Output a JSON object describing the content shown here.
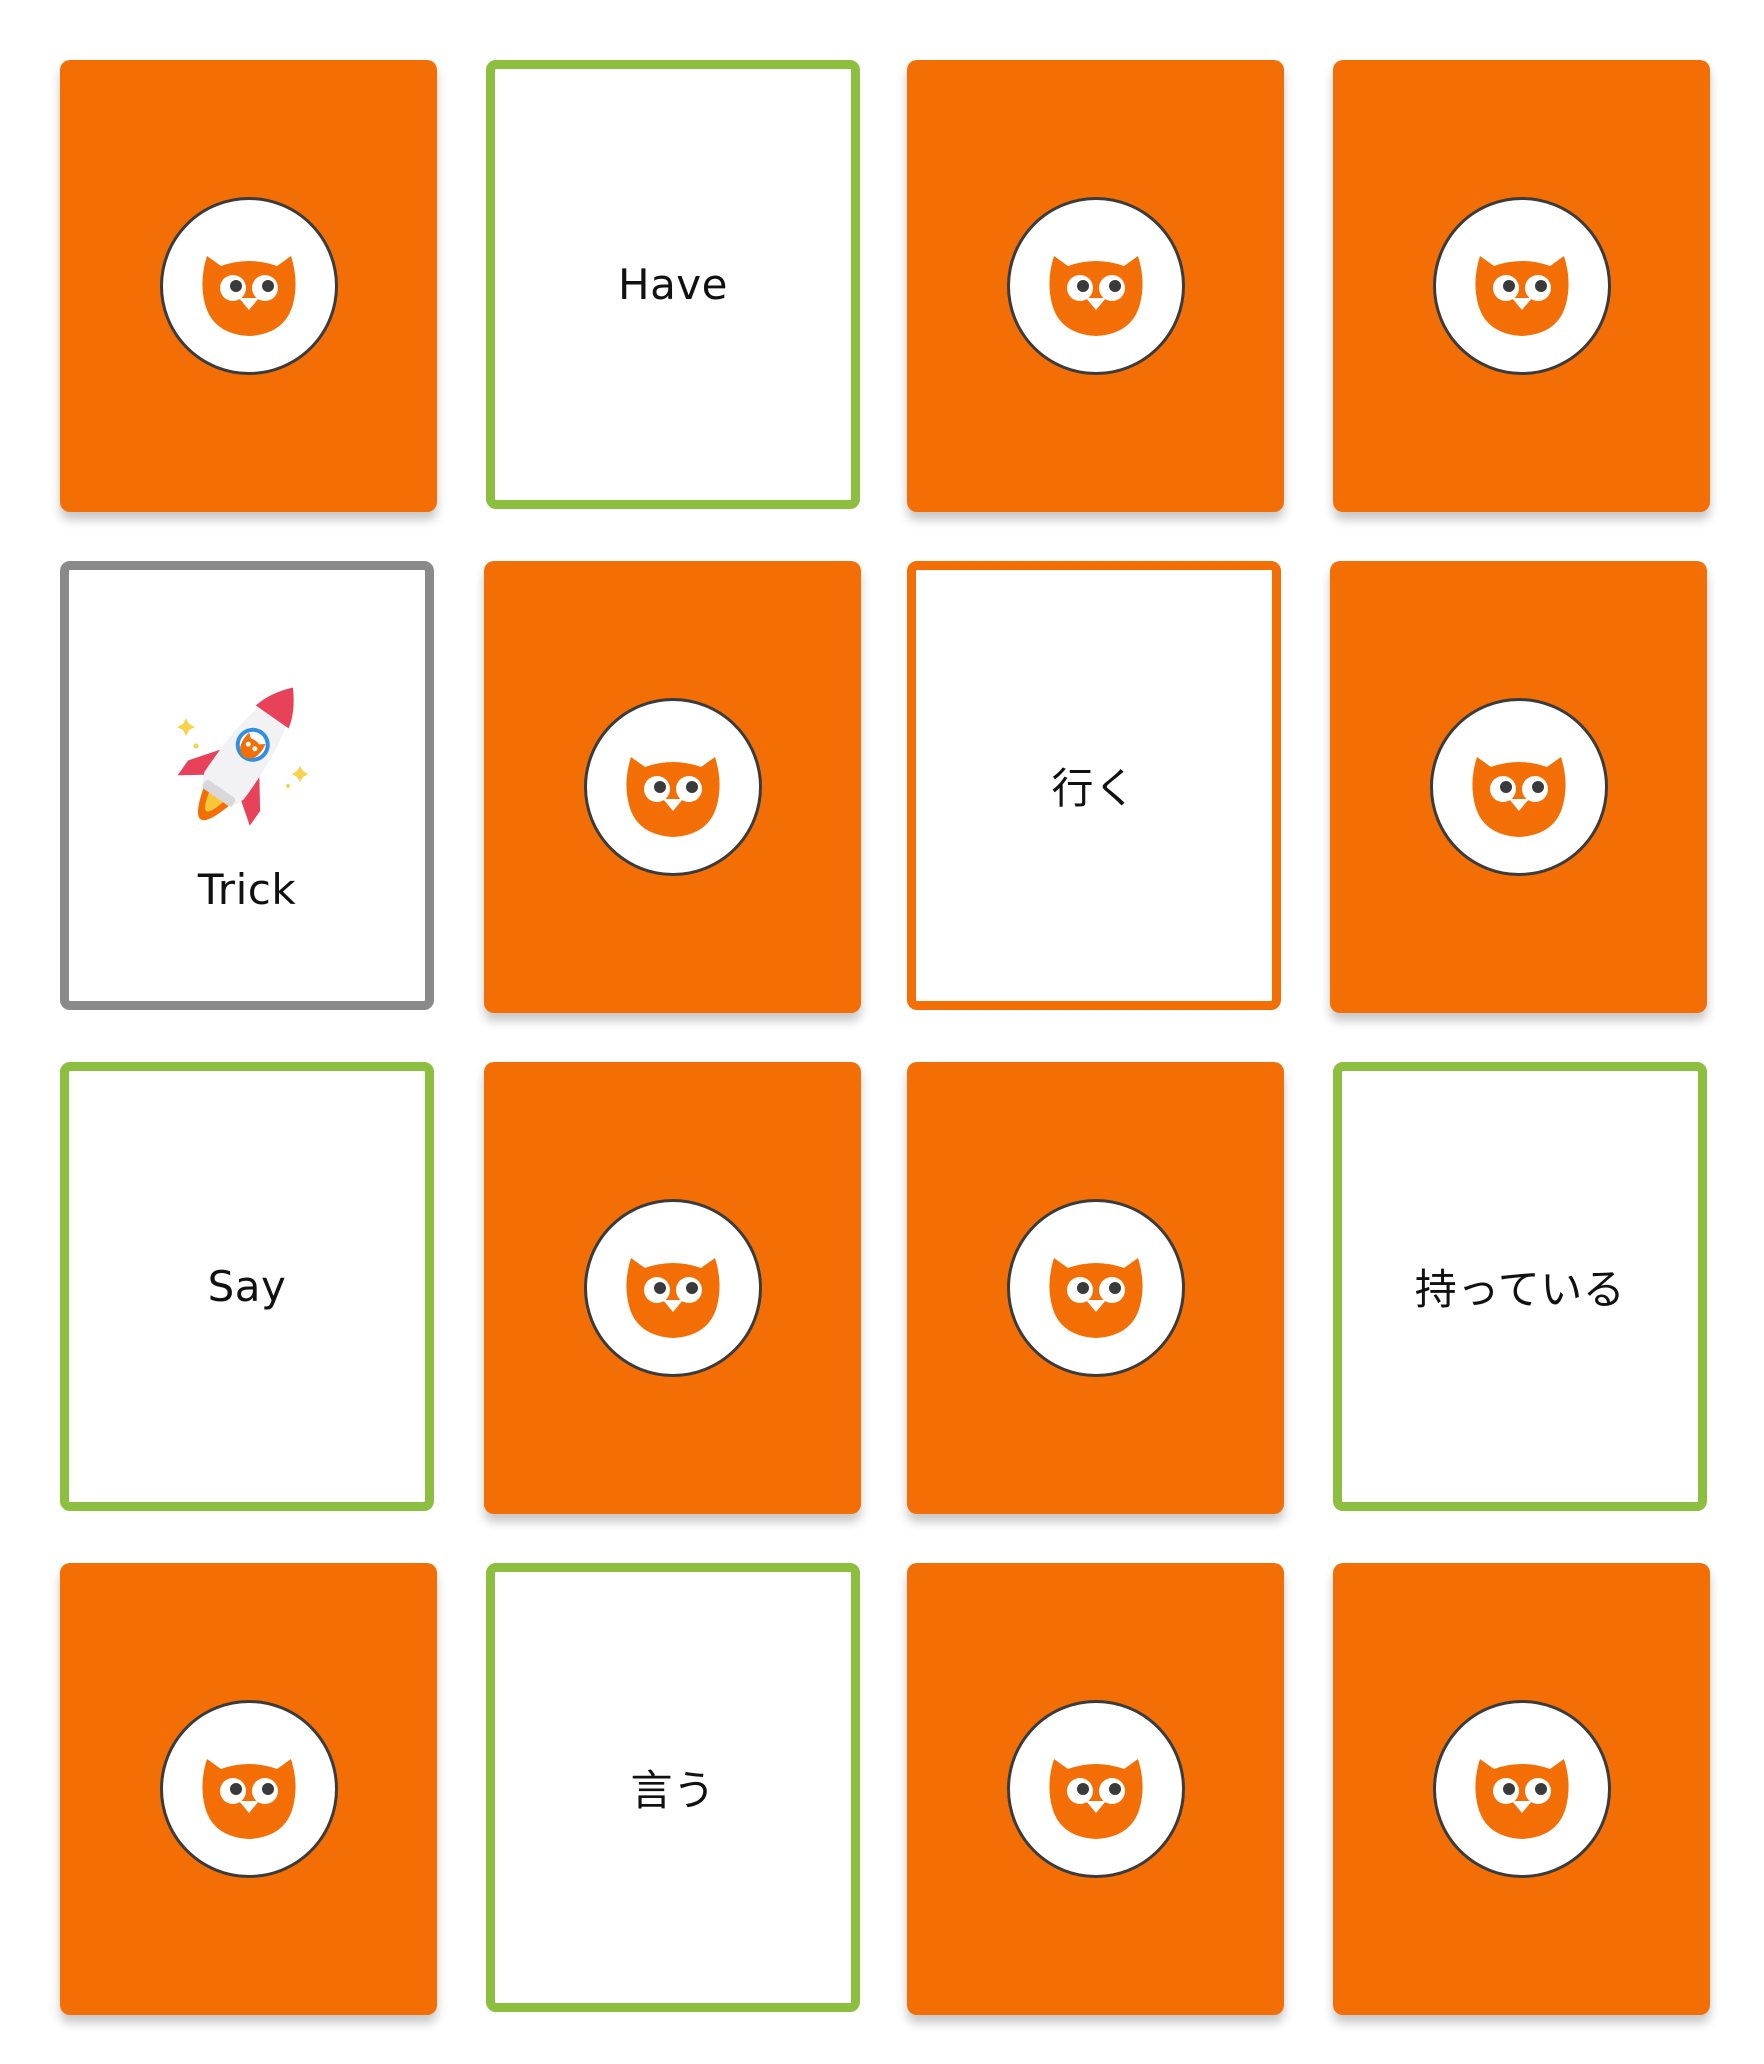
{
  "theme": {
    "back_color": "#f36f05",
    "matched_border": "#8cbe3f",
    "selected_border": "#f36f05",
    "wrong_border": "#8a8a8a"
  },
  "cards": [
    {
      "state": "back",
      "icon": "owl-icon"
    },
    {
      "state": "matched",
      "word": "Have"
    },
    {
      "state": "back",
      "icon": "owl-icon"
    },
    {
      "state": "back",
      "icon": "owl-icon"
    },
    {
      "state": "wrong",
      "word": "Trick",
      "icon": "rocket-icon"
    },
    {
      "state": "back",
      "icon": "owl-icon"
    },
    {
      "state": "selected",
      "word": "行く"
    },
    {
      "state": "back",
      "icon": "owl-icon"
    },
    {
      "state": "matched",
      "word": "Say"
    },
    {
      "state": "back",
      "icon": "owl-icon"
    },
    {
      "state": "back",
      "icon": "owl-icon"
    },
    {
      "state": "matched",
      "word": "持っている"
    },
    {
      "state": "back",
      "icon": "owl-icon"
    },
    {
      "state": "matched",
      "word": "言う"
    },
    {
      "state": "back",
      "icon": "owl-icon"
    },
    {
      "state": "back",
      "icon": "owl-icon"
    }
  ]
}
